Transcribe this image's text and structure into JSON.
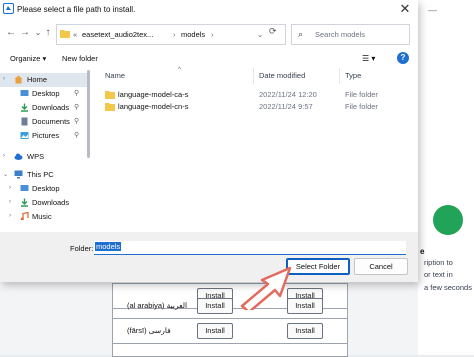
{
  "dialog": {
    "title": "Please select a file path to install.",
    "close_glyph": "✕"
  },
  "nav": {
    "back_glyph": "←",
    "forward_glyph": "→",
    "dropdown_glyph": "⌄",
    "up_glyph": "↑",
    "refresh_glyph": "⟳"
  },
  "address": {
    "prefix": "«",
    "crumb1": "easetext_audio2tex...",
    "sep": "›",
    "crumb2": "models",
    "dropdown": "⌄"
  },
  "search": {
    "placeholder": "Search models",
    "icon": "search-icon",
    "glyph": "⌕"
  },
  "toolbar": {
    "organize": "Organize ▾",
    "new_folder": "New folder",
    "view_glyph": "☰ ▾",
    "help": "?"
  },
  "sidebar": {
    "items": [
      {
        "label": "Home",
        "icon": "home-icon",
        "color": "#e8a33d",
        "pinned": false,
        "selected": true
      },
      {
        "label": "Desktop",
        "icon": "desktop-icon",
        "color": "#4a8fd8",
        "pinned": true
      },
      {
        "label": "Downloads",
        "icon": "downloads-icon",
        "color": "#2f9b57",
        "pinned": true
      },
      {
        "label": "Documents",
        "icon": "documents-icon",
        "color": "#6b7f99",
        "pinned": true
      },
      {
        "label": "Pictures",
        "icon": "pictures-icon",
        "color": "#3aa0d8",
        "pinned": true
      },
      {
        "label": "WPS",
        "icon": "cloud-icon",
        "color": "#1f6fd1",
        "pinned": false
      },
      {
        "label": "This PC",
        "icon": "computer-icon",
        "color": "#3b7fc4",
        "pinned": false
      },
      {
        "label": "Desktop",
        "icon": "desktop-icon",
        "color": "#4a8fd8",
        "pinned": false
      },
      {
        "label": "Downloads",
        "icon": "downloads-icon",
        "color": "#2f9b57",
        "pinned": false
      },
      {
        "label": "Music",
        "icon": "music-icon",
        "color": "#e0662c",
        "pinned": false
      }
    ],
    "pin_glyph": "📌"
  },
  "files": {
    "columns": {
      "name": "Name",
      "date": "Date modified",
      "type": "Type"
    },
    "sort_glyph": "^",
    "rows": [
      {
        "name": "language-model-ca-s",
        "date": "2022/11/24 12:20",
        "type": "File folder"
      },
      {
        "name": "language-model-cn-s",
        "date": "2022/11/24 9:57",
        "type": "File folder"
      }
    ]
  },
  "footer": {
    "folder_label": "Folder:",
    "folder_value": "models",
    "select_button": "Select Folder",
    "cancel_button": "Cancel"
  },
  "background": {
    "top_text": "—",
    "right_text": [
      "ription to",
      "or text in",
      "a few seconds"
    ],
    "title": "e",
    "table_rows": [
      {
        "lang": "",
        "button": "Install",
        "button2": "Install"
      },
      {
        "lang": "(al arabiya) العربية",
        "button": "Install",
        "button2": "Install"
      },
      {
        "lang": "(fārsī) فارسی",
        "button": "Install",
        "button2": "Install"
      }
    ]
  },
  "colors": {
    "accent": "#1f6fd1",
    "folder": "#f2c84b",
    "green": "#22a35a"
  }
}
